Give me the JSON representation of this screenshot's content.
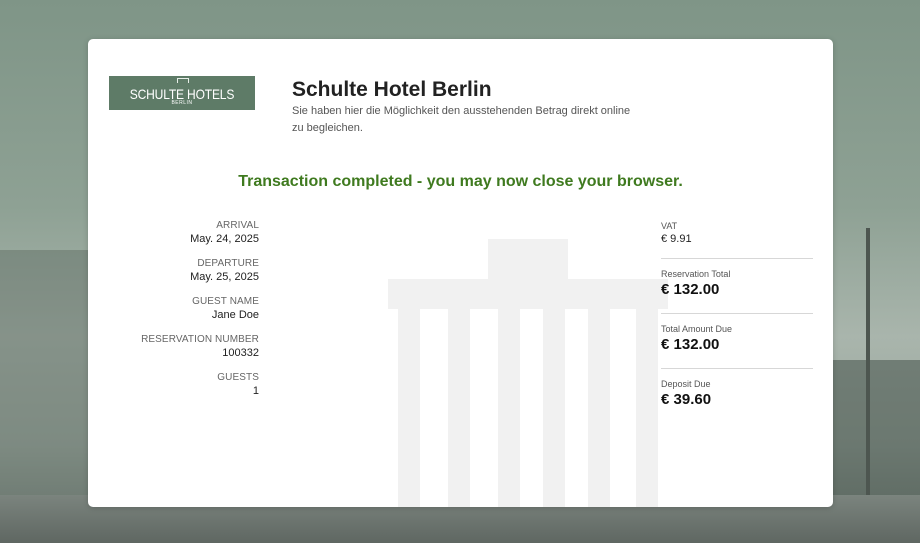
{
  "hotel": {
    "logo_main": "SCHULTE HOTELS",
    "logo_sub": "BERLIN",
    "name": "Schulte Hotel Berlin",
    "description": "Sie haben hier die Möglichkeit den ausstehenden Betrag direkt online zu begleichen."
  },
  "status_message": "Transaction completed - you may now close your browser.",
  "reservation": {
    "arrival_label": "ARRIVAL",
    "arrival_value": "May. 24, 2025",
    "departure_label": "DEPARTURE",
    "departure_value": "May. 25, 2025",
    "guest_name_label": "GUEST NAME",
    "guest_name_value": "Jane Doe",
    "number_label": "RESERVATION NUMBER",
    "number_value": "100332",
    "guests_label": "GUESTS",
    "guests_value": "1"
  },
  "summary": {
    "vat_label": "VAT",
    "vat_value": "€ 9.91",
    "reservation_total_label": "Reservation Total",
    "reservation_total_value": "€ 132.00",
    "total_due_label": "Total Amount Due",
    "total_due_value": "€ 132.00",
    "deposit_label": "Deposit Due",
    "deposit_value": "€ 39.60"
  },
  "colors": {
    "accent_green": "#3f7a1f",
    "logo_background": "#5e7b67"
  }
}
